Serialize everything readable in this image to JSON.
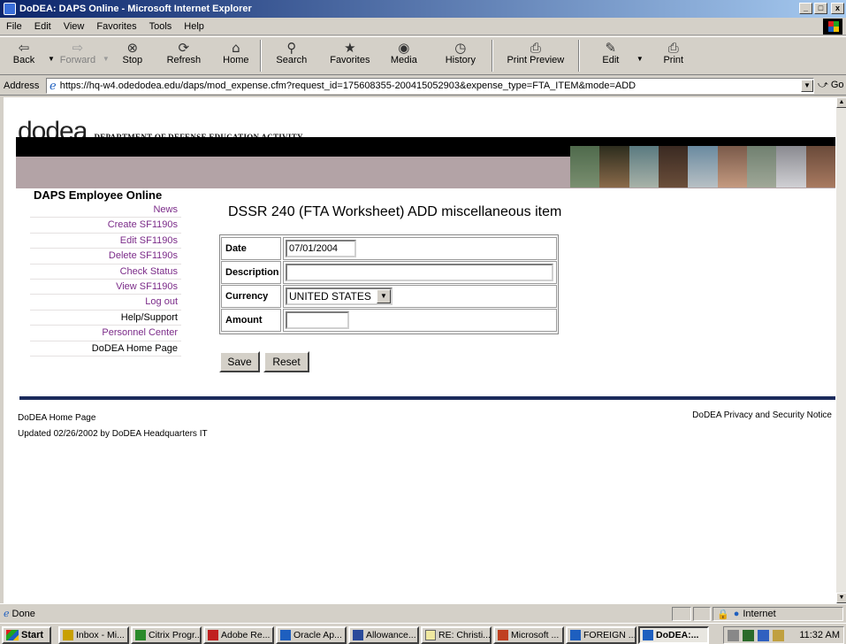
{
  "window": {
    "title": "DoDEA: DAPS Online - Microsoft Internet Explorer"
  },
  "menu": [
    "File",
    "Edit",
    "View",
    "Favorites",
    "Tools",
    "Help"
  ],
  "toolbar": {
    "back": "Back",
    "forward": "Forward",
    "stop": "Stop",
    "refresh": "Refresh",
    "home": "Home",
    "search": "Search",
    "favorites": "Favorites",
    "media": "Media",
    "history": "History",
    "print_preview": "Print Preview",
    "edit": "Edit",
    "print": "Print"
  },
  "address": {
    "label": "Address",
    "url": "https://hq-w4.odedodea.edu/daps/mod_expense.cfm?request_id=175608355-200415052903&expense_type=FTA_ITEM&mode=ADD",
    "go": "Go"
  },
  "header": {
    "logo": "dodea",
    "subtitle": "DEPARTMENT OF DEFENSE EDUCATION ACTIVITY"
  },
  "sidebar": {
    "title": "DAPS Employee Online",
    "items": [
      {
        "label": "News"
      },
      {
        "label": "Create SF1190s"
      },
      {
        "label": "Edit SF1190s"
      },
      {
        "label": "Delete SF1190s"
      },
      {
        "label": "Check Status"
      },
      {
        "label": "View SF1190s"
      },
      {
        "label": "Log out"
      },
      {
        "label": "Help/Support"
      },
      {
        "label": "Personnel Center"
      },
      {
        "label": "DoDEA Home Page"
      }
    ]
  },
  "page": {
    "title": "DSSR 240 (FTA Worksheet) ADD miscellaneous item"
  },
  "form": {
    "date_label": "Date",
    "date_value": "07/01/2004",
    "description_label": "Description",
    "description_value": "",
    "currency_label": "Currency",
    "currency_value": "UNITED STATES",
    "amount_label": "Amount",
    "amount_value": "",
    "save_label": "Save",
    "reset_label": "Reset"
  },
  "footer": {
    "home_link": "DoDEA Home Page",
    "updated": "Updated 02/26/2002 by DoDEA Headquarters IT",
    "privacy": "DoDEA Privacy and Security Notice"
  },
  "status": {
    "text": "Done",
    "zone": "Internet"
  },
  "taskbar": {
    "start": "Start",
    "tasks": [
      {
        "label": "Inbox - Mi..."
      },
      {
        "label": "Citrix Progr..."
      },
      {
        "label": "Adobe Re..."
      },
      {
        "label": "Oracle Ap..."
      },
      {
        "label": "Allowance..."
      },
      {
        "label": "RE: Christi..."
      },
      {
        "label": "Microsoft ..."
      },
      {
        "label": "FOREIGN ..."
      },
      {
        "label": "DoDEA:..."
      }
    ],
    "clock": "11:32 AM"
  },
  "colors": {
    "link": "#7b2b89",
    "titlebar": "#0a246a",
    "band": "#b3a3a6"
  }
}
